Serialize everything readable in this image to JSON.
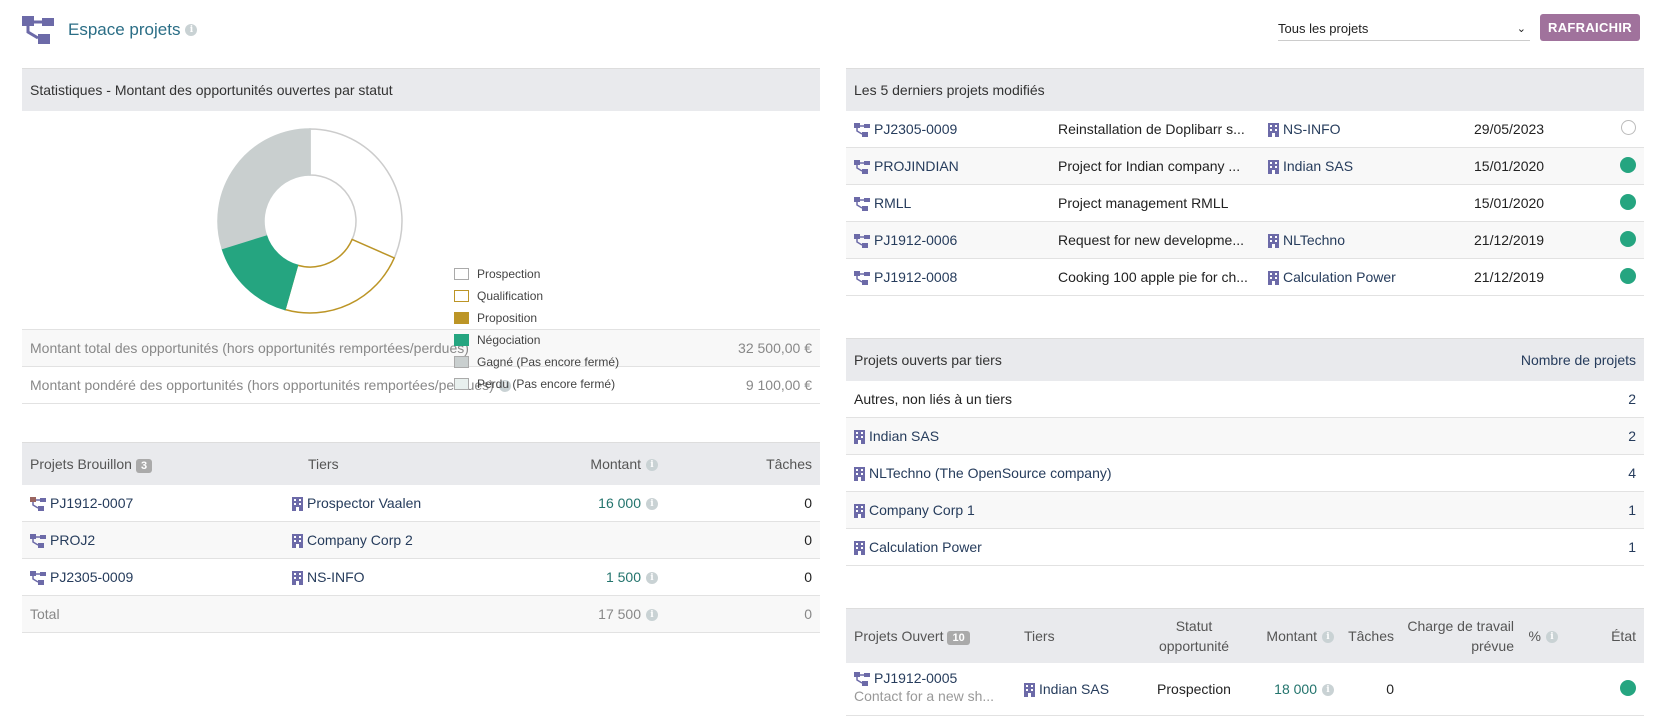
{
  "header": {
    "title": "Espace projets",
    "select_value": "Tous les projets",
    "refresh_label": "RAFRAICHIR"
  },
  "stats": {
    "title": "Statistiques - Montant des opportunités ouvertes par statut",
    "total_label": "Montant total des opportunités (hors opportunités remportées/perdues)",
    "total_value": "32 500,00 €",
    "weighted_label": "Montant pondéré des opportunités (hors opportunités remportées/perdues)",
    "weighted_value": "9 100,00 €"
  },
  "chart_data": {
    "type": "pie",
    "labels": [
      "Prospection",
      "Qualification",
      "Proposition",
      "Négociation",
      "Gagné (Pas encore fermé)",
      "Perdu (Pas encore fermé)"
    ],
    "values": [
      9000,
      6500,
      0,
      4500,
      8500,
      0
    ],
    "colors": [
      "#ffffff",
      "#ffffff",
      "#bc9526",
      "#25a580",
      "#c9cfcf",
      "#e8f0ee"
    ],
    "strokes": [
      "#cccccc",
      "#bc9526",
      "#bc9526",
      "#25a580",
      "#c9cfcf",
      "#cccccc"
    ],
    "legend_swatch": [
      "#ffffff",
      "#ffffff",
      "#bc9526",
      "#25a580",
      "#c9cfcf",
      "#e8f0ee"
    ],
    "legend_border": [
      "#aaaaaa",
      "#bc9526",
      "#bc9526",
      "#25a580",
      "#aaaaaa",
      "#aaaaaa"
    ],
    "legend": "right"
  },
  "last5": {
    "title": "Les 5 derniers projets modifiés",
    "rows": [
      {
        "ref": "PJ2305-0009",
        "desc": "Reinstallation de Doplibarr s...",
        "tiers": "NS-INFO",
        "date": "29/05/2023",
        "status": "empty"
      },
      {
        "ref": "PROJINDIAN",
        "desc": "Project for Indian company ...",
        "tiers": "Indian SAS",
        "date": "15/01/2020",
        "status": "green"
      },
      {
        "ref": "RMLL",
        "desc": "Project management RMLL",
        "tiers": "",
        "date": "15/01/2020",
        "status": "green"
      },
      {
        "ref": "PJ1912-0006",
        "desc": "Request for new developme...",
        "tiers": "NLTechno",
        "date": "21/12/2019",
        "status": "green"
      },
      {
        "ref": "PJ1912-0008",
        "desc": "Cooking 100 apple pie for ch...",
        "tiers": "Calculation Power",
        "date": "21/12/2019",
        "status": "green"
      }
    ]
  },
  "bytiers": {
    "title": "Projets ouverts par tiers",
    "count_header": "Nombre de projets",
    "rows": [
      {
        "name": "Autres, non liés à un tiers",
        "count": "2",
        "icon": false
      },
      {
        "name": "Indian SAS",
        "count": "2",
        "icon": true
      },
      {
        "name": "NLTechno (The OpenSource company)",
        "count": "4",
        "icon": true
      },
      {
        "name": "Company Corp 1",
        "count": "1",
        "icon": true
      },
      {
        "name": "Calculation Power",
        "count": "1",
        "icon": true
      }
    ]
  },
  "drafts": {
    "title": "Projets Brouillon",
    "count": "3",
    "col_tiers": "Tiers",
    "col_amount": "Montant",
    "col_tasks": "Tâches",
    "rows": [
      {
        "ref": "PJ1912-0007",
        "tiers": "Prospector Vaalen",
        "amount": "16 000",
        "tasks": "0",
        "draft": true
      },
      {
        "ref": "PROJ2",
        "tiers": "Company Corp 2",
        "amount": "",
        "tasks": "0",
        "draft": false
      },
      {
        "ref": "PJ2305-0009",
        "tiers": "NS-INFO",
        "amount": "1 500",
        "tasks": "0",
        "draft": false
      }
    ],
    "total_label": "Total",
    "total_amount": "17 500",
    "total_tasks": "0"
  },
  "open": {
    "title": "Projets Ouvert",
    "count": "10",
    "col_tiers": "Tiers",
    "col_status": "Statut opportunité",
    "col_amount": "Montant",
    "col_tasks": "Tâches",
    "col_charge": "Charge de travail prévue",
    "col_pct": "%",
    "col_state": "État",
    "rows": [
      {
        "ref": "PJ1912-0005",
        "sub": "Contact for a new sh...",
        "tiers": "Indian SAS",
        "status": "Prospection",
        "amount": "18 000",
        "tasks": "0",
        "charge": "",
        "pct": ""
      }
    ]
  }
}
